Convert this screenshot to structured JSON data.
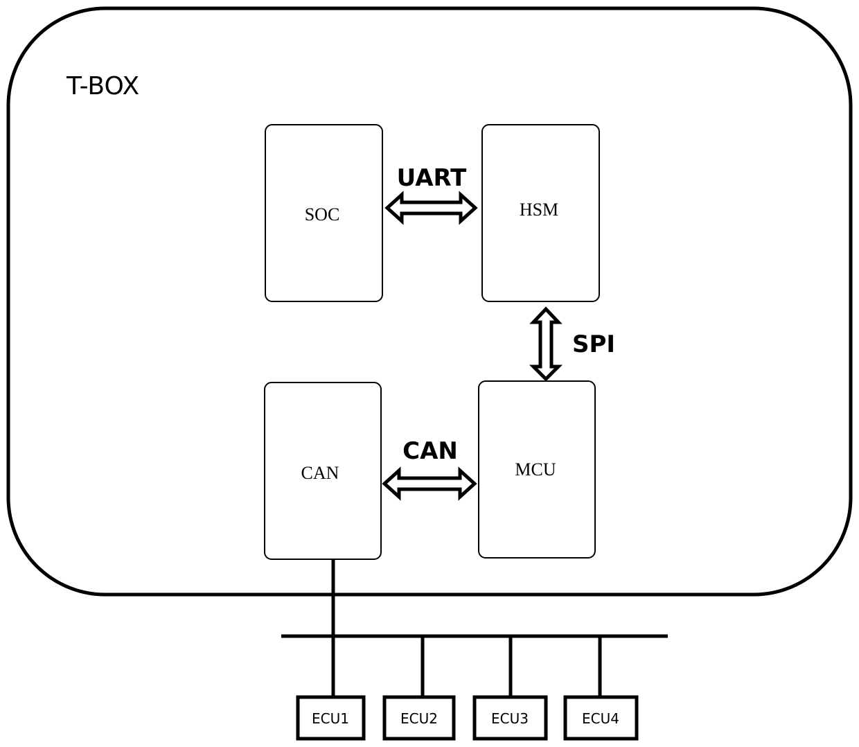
{
  "diagram": {
    "container": {
      "label": "T-BOX"
    },
    "modules": {
      "soc": {
        "label": "SOC"
      },
      "hsm": {
        "label": "HSM"
      },
      "can": {
        "label": "CAN"
      },
      "mcu": {
        "label": "MCU"
      }
    },
    "links": {
      "soc_hsm": {
        "label": "UART",
        "direction": "bidirectional"
      },
      "hsm_mcu": {
        "label": "SPI",
        "direction": "bidirectional"
      },
      "can_mcu": {
        "label": "CAN",
        "direction": "bidirectional"
      }
    },
    "bus": {
      "ecus": [
        {
          "label": "ECU1"
        },
        {
          "label": "ECU2"
        },
        {
          "label": "ECU3"
        },
        {
          "label": "ECU4"
        }
      ]
    }
  }
}
